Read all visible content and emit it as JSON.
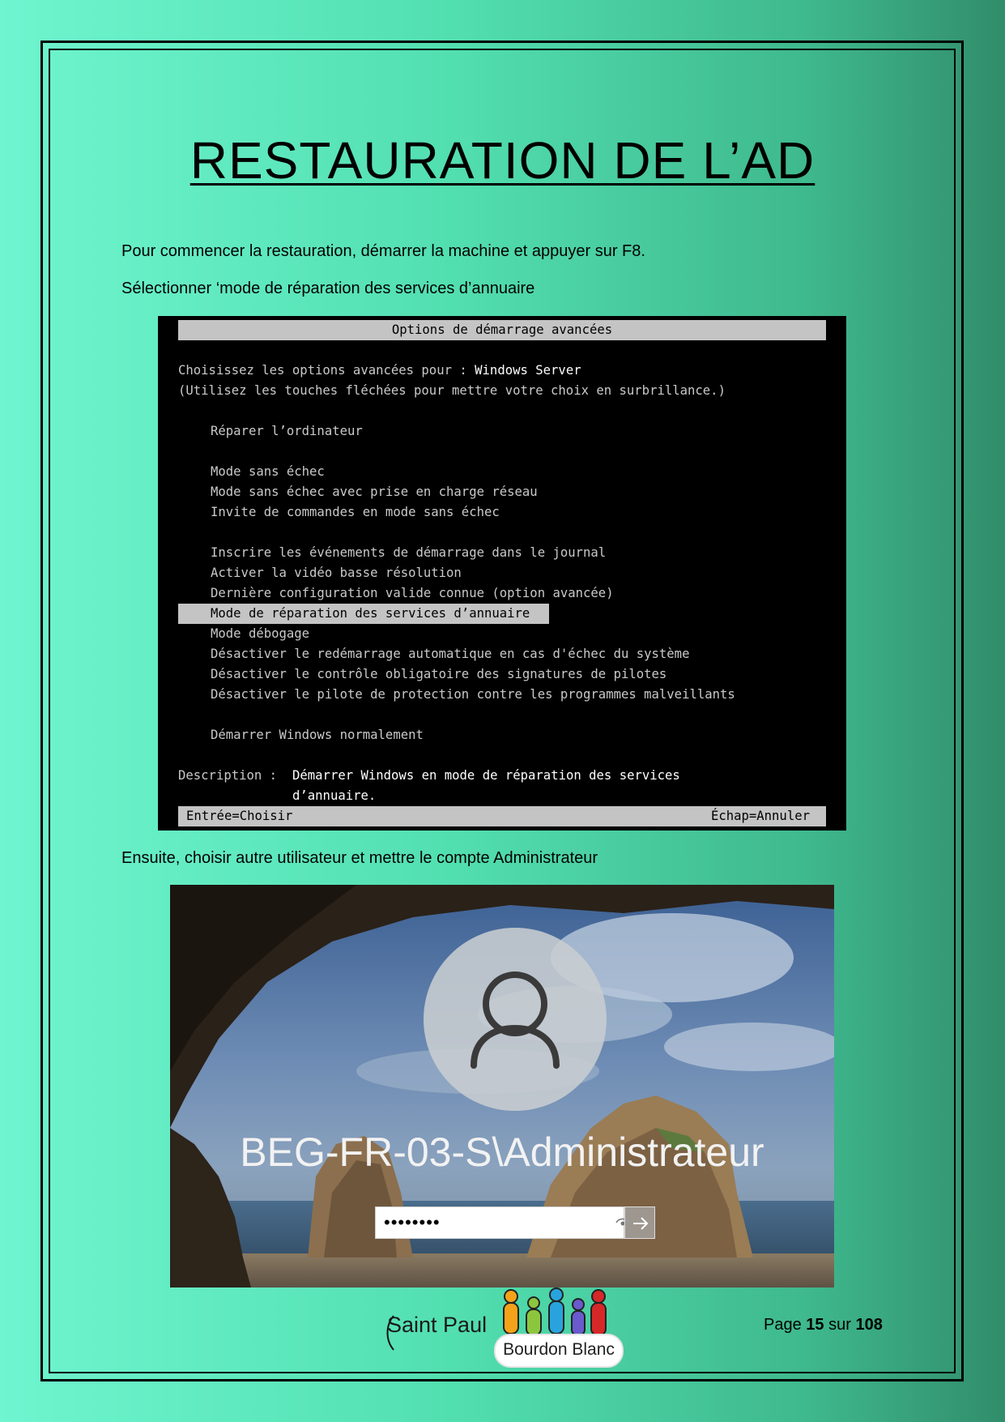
{
  "title": "RESTAURATION DE L’AD",
  "paragraphs": {
    "p1": "Pour commencer la restauration, démarrer la machine et appuyer sur F8.",
    "p2": "Sélectionner ‘mode de réparation des services d’annuaire",
    "p3": "Ensuite, choisir autre utilisateur et mettre le compte Administrateur"
  },
  "boot_menu": {
    "header": "Options de démarrage avancées",
    "choose_prefix": "Choisissez les options avancées pour : ",
    "choose_os": "Windows Server",
    "instruction": "(Utilisez les touches fléchées pour mettre votre choix en surbrillance.)",
    "options": {
      "repair": "Réparer l’ordinateur",
      "safe": "Mode sans échec",
      "safe_net": "Mode sans échec avec prise en charge réseau",
      "safe_cmd": "Invite de commandes en mode sans échec",
      "boot_log": "Inscrire les événements de démarrage dans le journal",
      "low_res": "Activer la vidéo basse résolution",
      "last_known": "Dernière configuration valide connue (option avancée)",
      "dsrm": "Mode de réparation des services d’annuaire",
      "debug": "Mode débogage",
      "no_restart": "Désactiver le redémarrage automatique en cas d'échec du système",
      "no_sig": "Désactiver le contrôle obligatoire des signatures de pilotes",
      "no_elam": "Désactiver le pilote de protection contre les programmes malveillants",
      "normal": "Démarrer Windows normalement"
    },
    "description_label": "Description : ",
    "description_line1": "Démarrer Windows en mode de réparation des services",
    "description_line2": "d’annuaire.",
    "footer_left": "Entrée=Choisir",
    "footer_right": "Échap=Annuler"
  },
  "login": {
    "username": "BEG-FR-03-S\\Administrateur",
    "password_masked": "••••••••"
  },
  "footer": {
    "logo_text_1": "Saint Paul",
    "logo_text_2": "Bourdon Blanc",
    "page_label": "Page",
    "page_current": "15",
    "page_of": "sur",
    "page_total": "108"
  }
}
